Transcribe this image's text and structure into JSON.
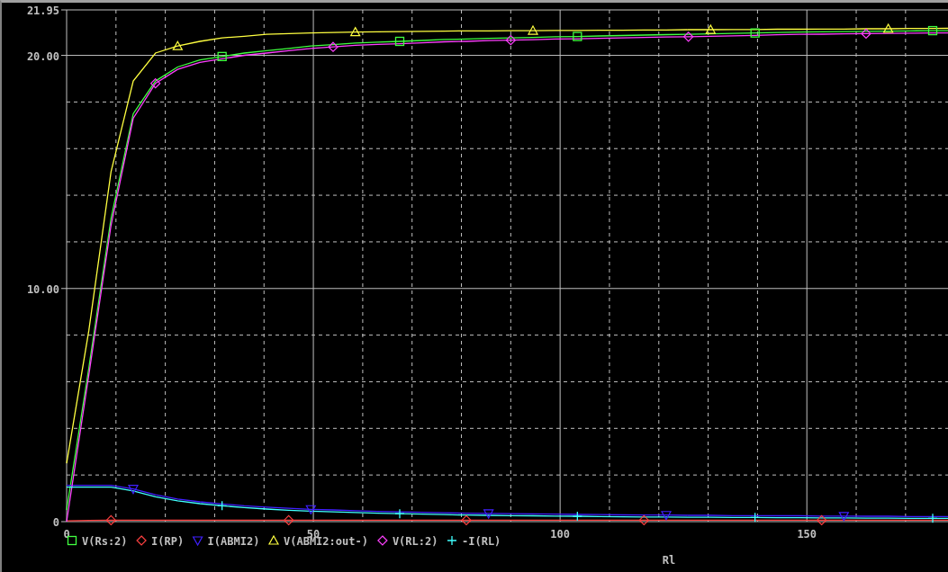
{
  "plot": {
    "markers": [
      {
        "kind": "square"
      },
      {
        "kind": "diamond"
      },
      {
        "kind": "triangle-down"
      },
      {
        "kind": "triangle-up"
      },
      {
        "kind": "diamond"
      },
      {
        "kind": "plus"
      }
    ],
    "chart_data": {
      "type": "line",
      "xlabel": "Rl",
      "grid": true,
      "legend": true,
      "xlim": [
        0,
        178.6
      ],
      "ylim": [
        0,
        21.95
      ],
      "xticks": [
        0,
        50,
        100,
        150
      ],
      "yticks": [
        {
          "value": 0,
          "label": "0"
        },
        {
          "value": 10,
          "label": "10.00"
        },
        {
          "value": 20,
          "label": "20.00"
        },
        {
          "value": 21.95,
          "label": "21.95"
        }
      ],
      "x": [
        0,
        4.5,
        9,
        13.5,
        18,
        22.5,
        27,
        31.5,
        36,
        40.5,
        45,
        49.5,
        54,
        58.5,
        63,
        67.5,
        72,
        76.5,
        81,
        85.5,
        90,
        94.5,
        99,
        103.5,
        108,
        112.5,
        117,
        121.5,
        126,
        130.5,
        135,
        139.5,
        144,
        148.5,
        153,
        157.5,
        162,
        166.5,
        171,
        175.5,
        178.6
      ],
      "series": [
        {
          "name": "V(Rs:2)",
          "color": "#40ff40",
          "values": [
            0.5,
            6.6,
            13.0,
            17.5,
            18.9,
            19.5,
            19.8,
            19.95,
            20.1,
            20.2,
            20.3,
            20.4,
            20.46,
            20.53,
            20.57,
            20.6,
            20.64,
            20.68,
            20.7,
            20.73,
            20.75,
            20.77,
            20.8,
            20.81,
            20.83,
            20.85,
            20.87,
            20.89,
            20.9,
            20.92,
            20.94,
            20.96,
            20.98,
            21.0,
            21.01,
            21.02,
            21.03,
            21.04,
            21.05,
            21.06,
            21.06
          ]
        },
        {
          "name": "I(RP)",
          "color": "#ff4040",
          "values": [
            0.03,
            0.05,
            0.06,
            0.06,
            0.06,
            0.06,
            0.06,
            0.06,
            0.06,
            0.06,
            0.06,
            0.06,
            0.06,
            0.06,
            0.06,
            0.06,
            0.06,
            0.06,
            0.06,
            0.06,
            0.06,
            0.06,
            0.06,
            0.06,
            0.06,
            0.06,
            0.06,
            0.06,
            0.06,
            0.06,
            0.06,
            0.06,
            0.06,
            0.06,
            0.06,
            0.06,
            0.06,
            0.06,
            0.06,
            0.06,
            0.06
          ]
        },
        {
          "name": "I(ABMI2)",
          "color": "#4020ff",
          "values": [
            1.56,
            1.56,
            1.56,
            1.4,
            1.15,
            0.97,
            0.85,
            0.76,
            0.68,
            0.62,
            0.57,
            0.53,
            0.5,
            0.47,
            0.44,
            0.42,
            0.4,
            0.38,
            0.36,
            0.35,
            0.34,
            0.33,
            0.32,
            0.31,
            0.3,
            0.29,
            0.28,
            0.28,
            0.27,
            0.27,
            0.26,
            0.26,
            0.25,
            0.25,
            0.24,
            0.24,
            0.23,
            0.23,
            0.22,
            0.22,
            0.22
          ]
        },
        {
          "name": "V(ABMI2:out-)",
          "color": "#ffff40",
          "values": [
            2.5,
            8.2,
            15.0,
            18.9,
            20.1,
            20.4,
            20.6,
            20.75,
            20.82,
            20.9,
            20.93,
            20.96,
            20.98,
            21.0,
            21.01,
            21.02,
            21.03,
            21.04,
            21.05,
            21.05,
            21.06,
            21.06,
            21.07,
            21.07,
            21.08,
            21.08,
            21.09,
            21.09,
            21.1,
            21.1,
            21.11,
            21.11,
            21.12,
            21.12,
            21.13,
            21.13,
            21.14,
            21.14,
            21.15,
            21.15,
            21.16
          ]
        },
        {
          "name": "V(RL:2)",
          "color": "#ff40ff",
          "values": [
            0,
            6.3,
            12.7,
            17.3,
            18.8,
            19.4,
            19.7,
            19.85,
            20.0,
            20.1,
            20.2,
            20.3,
            20.36,
            20.43,
            20.47,
            20.5,
            20.54,
            20.58,
            20.6,
            20.63,
            20.65,
            20.67,
            20.7,
            20.71,
            20.73,
            20.75,
            20.77,
            20.79,
            20.8,
            20.82,
            20.84,
            20.86,
            20.88,
            20.9,
            20.91,
            20.92,
            20.93,
            20.94,
            20.95,
            20.96,
            20.96
          ]
        },
        {
          "name": "-I(RL)",
          "color": "#40ffff",
          "values": [
            1.48,
            1.48,
            1.48,
            1.32,
            1.07,
            0.89,
            0.77,
            0.68,
            0.6,
            0.54,
            0.49,
            0.45,
            0.42,
            0.39,
            0.36,
            0.34,
            0.32,
            0.3,
            0.28,
            0.27,
            0.26,
            0.25,
            0.24,
            0.23,
            0.22,
            0.21,
            0.2,
            0.2,
            0.19,
            0.19,
            0.18,
            0.18,
            0.17,
            0.17,
            0.16,
            0.16,
            0.15,
            0.15,
            0.14,
            0.14,
            0.14
          ]
        }
      ]
    }
  }
}
